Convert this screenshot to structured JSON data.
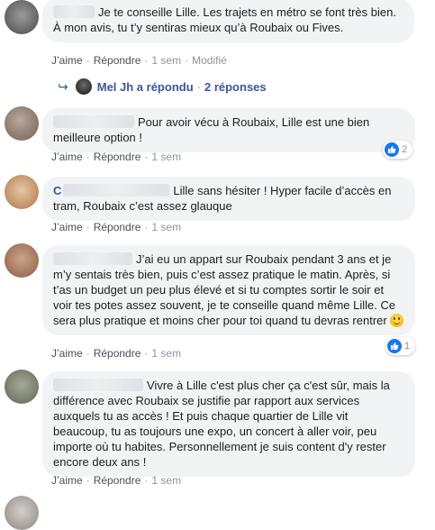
{
  "actions": {
    "like": "J’aime",
    "reply": "Répondre",
    "separator": "·",
    "modified": "Modifié"
  },
  "comments": [
    {
      "text": "Je te conseille Lille. Les trajets en métro se font très bien. À mon avis, tu t’y sentiras mieux qu’à Roubaix ou Fives.",
      "time": "1 sem"
    },
    {
      "text": "Pour avoir vécu à Roubaix, Lille est une bien meilleure option !",
      "time": "1 sem",
      "reactions": "2"
    },
    {
      "author_initial": "C",
      "text": "Lille sans hésiter ! Hyper facile d’accès en tram, Roubaix c’est assez glauque",
      "time": "1 sem"
    },
    {
      "text": "J’ai eu un appart sur Roubaix pendant 3 ans et je m’y sentais très bien, puis c’est assez pratique le matin. Après, si t’as un budget un peu plus élevé et si tu comptes sortir le soir et voir tes potes assez souvent, je te conseille quand même Lille. Ce sera plus pratique et moins cher pour toi quand tu devras rentrer",
      "time": "1 sem",
      "reactions": "1"
    },
    {
      "text": "Vivre à Lille c'est plus cher ça c'est sûr, mais la différence avec Roubaix se justifie par rapport aux services auxquels tu as accès ! Et puis chaque quartier de Lille vit beaucoup, tu as toujours une expo, un concert à aller voir, peu importe où tu habites. Personnellement je suis content d'y rester encore deux ans !",
      "time": "1 sem"
    }
  ],
  "replies_summary": {
    "text": "Mel Jh a répondu",
    "count": "2 réponses"
  }
}
